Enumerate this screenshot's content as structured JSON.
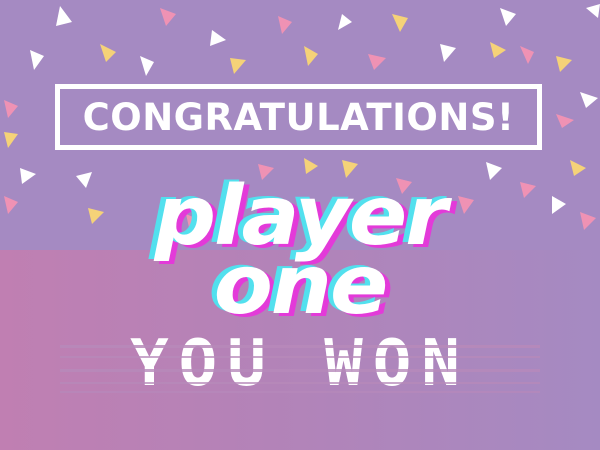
{
  "banner": {
    "text": "CONGRATULATIONS!"
  },
  "headline": {
    "line1": "player",
    "line2": "one"
  },
  "subline": {
    "text": "YOU WON"
  },
  "colors": {
    "background_top": "#a58ac2",
    "background_bottom_left": "#c07fb2",
    "background_bottom_right": "#a58ac2",
    "text": "#ffffff",
    "glitch_cyan": "#52e0ee",
    "glitch_magenta": "#e33ad9",
    "confetti_pink": "#ef92b4",
    "confetti_yellow": "#f5d278",
    "confetti_white": "#ffffff"
  }
}
